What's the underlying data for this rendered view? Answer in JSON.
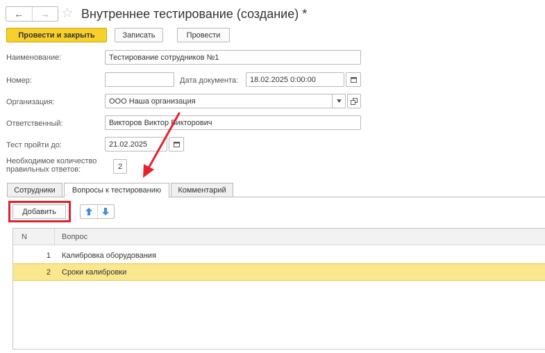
{
  "header": {
    "back_icon": "←",
    "forward_icon": "→",
    "star_icon": "☆",
    "title": "Внутреннее тестирование (создание) *"
  },
  "toolbar": {
    "post_close_label": "Провести и закрыть",
    "save_label": "Записать",
    "post_label": "Провести"
  },
  "form": {
    "name_label": "Наименование:",
    "name_value": "Тестирование сотрудников №1",
    "number_label": "Номер:",
    "number_value": "",
    "date_label": "Дата документа:",
    "date_value": "18.02.2025  0:00:00",
    "org_label": "Организация:",
    "org_value": "ООО Наша организация",
    "responsible_label": "Ответственный:",
    "responsible_value": "Викторов Виктор Викторович",
    "deadline_label": "Тест пройти до:",
    "deadline_value": "21.02.2025",
    "required_label_line1": "Необходимое количество",
    "required_label_line2": "правильных ответов:",
    "required_value": "2"
  },
  "tabs": [
    {
      "label": "Сотрудники"
    },
    {
      "label": "Вопросы к тестированию"
    },
    {
      "label": "Комментарий"
    }
  ],
  "questions_toolbar": {
    "add_label": "Добавить"
  },
  "table": {
    "headers": [
      "N",
      "Вопрос"
    ],
    "rows": [
      {
        "n": "1",
        "question": "Калибровка оборудования"
      },
      {
        "n": "2",
        "question": "Сроки калибровки"
      }
    ]
  },
  "colors": {
    "primary_button": "#f7d02c",
    "selected_row": "#fbe78d",
    "highlight_box": "#e0202a",
    "annotation_arrow": "#e5232c",
    "move_arrows": "#3b8fd9"
  },
  "icons": {
    "calendar": "calendar-icon",
    "dropdown": "chevron-down-icon",
    "open": "open-link-icon",
    "move_up": "arrow-up-icon",
    "move_down": "arrow-down-icon"
  }
}
